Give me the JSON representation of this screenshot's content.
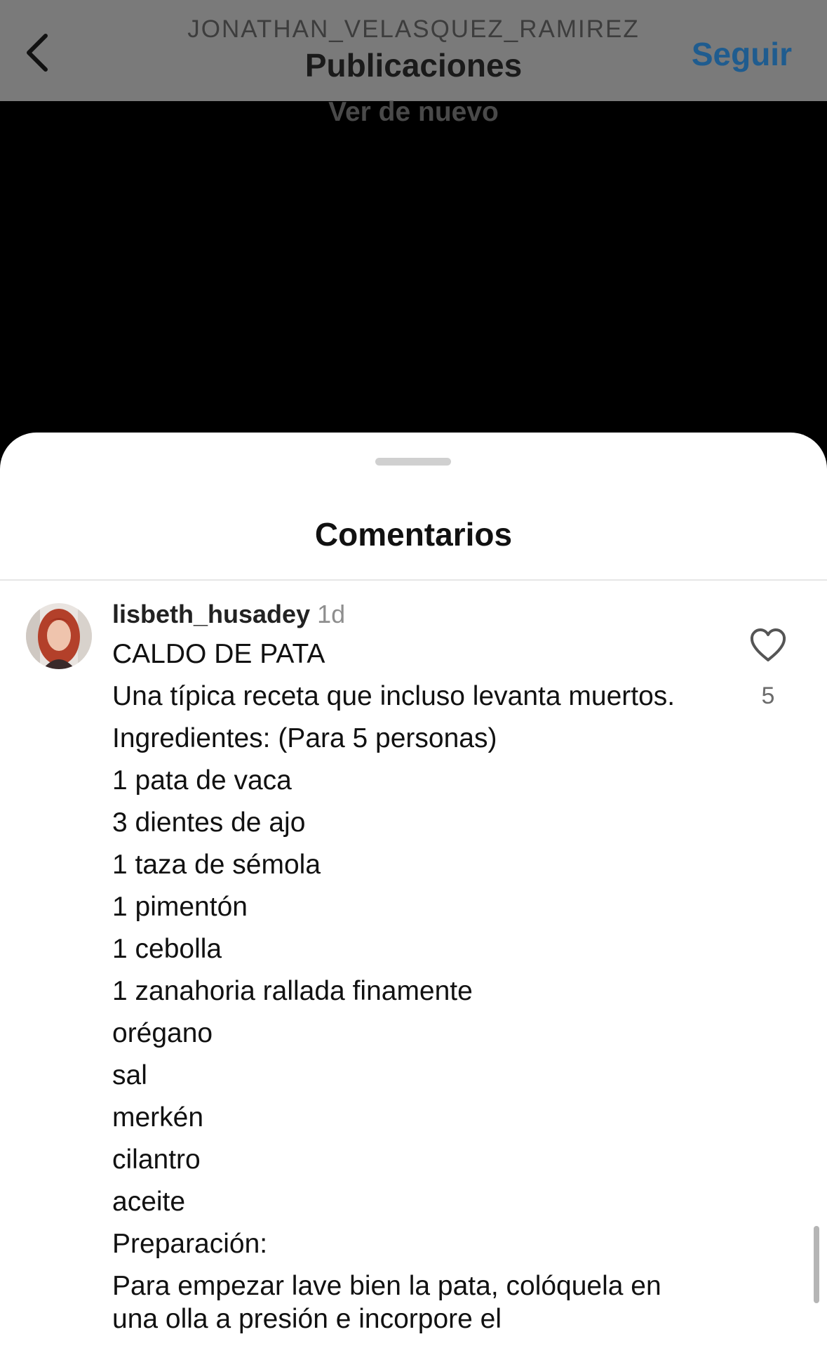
{
  "header": {
    "subtitle": "JONATHAN_VELASQUEZ_RAMIREZ",
    "title": "Publicaciones",
    "follow_label": "Seguir",
    "back_icon": "chevron-left-icon"
  },
  "video": {
    "replay_label": "Ver de nuevo"
  },
  "comments_sheet": {
    "title": "Comentarios",
    "comment": {
      "username": "lisbeth_husadey",
      "timestamp": "1d",
      "likes": "5",
      "like_icon": "heart-outline-icon",
      "lines": [
        "CALDO DE PATA",
        "Una típica receta que incluso levanta muertos.",
        "Ingredientes: (Para 5 personas)",
        "1 pata de vaca",
        "3 dientes de ajo",
        "1 taza de sémola",
        "1 pimentón",
        "1 cebolla",
        "1 zanahoria rallada finamente",
        "orégano",
        "sal",
        "merkén",
        "cilantro",
        "aceite",
        "Preparación:",
        "Para empezar lave bien la pata, colóquela en una olla a presión e incorpore el"
      ]
    }
  },
  "colors": {
    "header_dim": "#7a7a7a",
    "follow_blue": "#1f5c8f",
    "video_bg": "#000000",
    "sheet_bg": "#ffffff"
  }
}
